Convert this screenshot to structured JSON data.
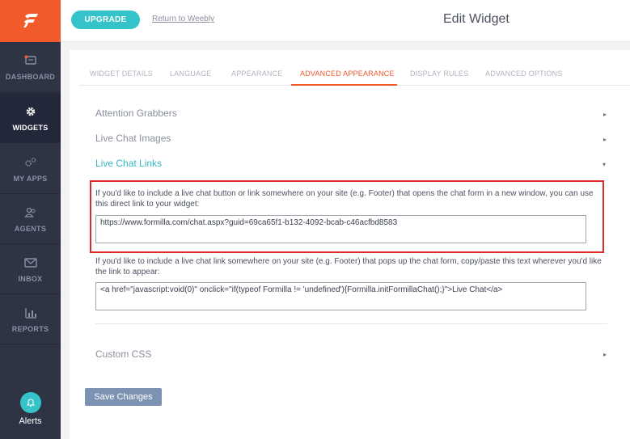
{
  "sidebar": {
    "items": [
      {
        "label": "DASHBOARD",
        "icon": "dashboard-icon"
      },
      {
        "label": "WIDGETS",
        "icon": "gear-icon",
        "active": true
      },
      {
        "label": "MY APPS",
        "icon": "apps-gears-icon"
      },
      {
        "label": "AGENTS",
        "icon": "agents-icon"
      },
      {
        "label": "INBOX",
        "icon": "inbox-icon"
      },
      {
        "label": "REPORTS",
        "icon": "reports-icon"
      }
    ],
    "alerts_label": "Alerts"
  },
  "topbar": {
    "upgrade_label": "UPGRADE",
    "return_label": "Return to Weebly",
    "title": "Edit Widget"
  },
  "tabs": [
    {
      "label": "WIDGET DETAILS"
    },
    {
      "label": "LANGUAGE"
    },
    {
      "label": "APPEARANCE"
    },
    {
      "label": "ADVANCED APPEARANCE",
      "active": true
    },
    {
      "label": "DISPLAY RULES"
    },
    {
      "label": "ADVANCED OPTIONS"
    }
  ],
  "sections": {
    "attention_grabbers": "Attention Grabbers",
    "live_chat_images": "Live Chat Images",
    "live_chat_links": "Live Chat Links",
    "custom_css": "Custom CSS"
  },
  "links": {
    "direct_desc": "If you'd like to include a live chat button or link somewhere on your site (e.g. Footer) that opens the chat form in a new window, you can use this direct link to your widget:",
    "direct_value": "https://www.formilla.com/chat.aspx?guid=69ca65f1-b132-4092-bcab-c46acfbd8583",
    "popup_desc": "If you'd like to include a live chat link somewhere on your site (e.g. Footer) that pops up the chat form, copy/paste this text wherever you'd like the link to appear:",
    "popup_value": "<a href=\"javascript:void(0)\" onclick=\"if(typeof Formilla != 'undefined'){Formilla.initFormillaChat();}\">Live Chat</a>"
  },
  "save_label": "Save Changes",
  "colors": {
    "brand_orange": "#f15a2b",
    "accent_teal": "#33c3c8",
    "sidebar_bg": "#2f3445",
    "highlight_red": "#e02a2a"
  }
}
